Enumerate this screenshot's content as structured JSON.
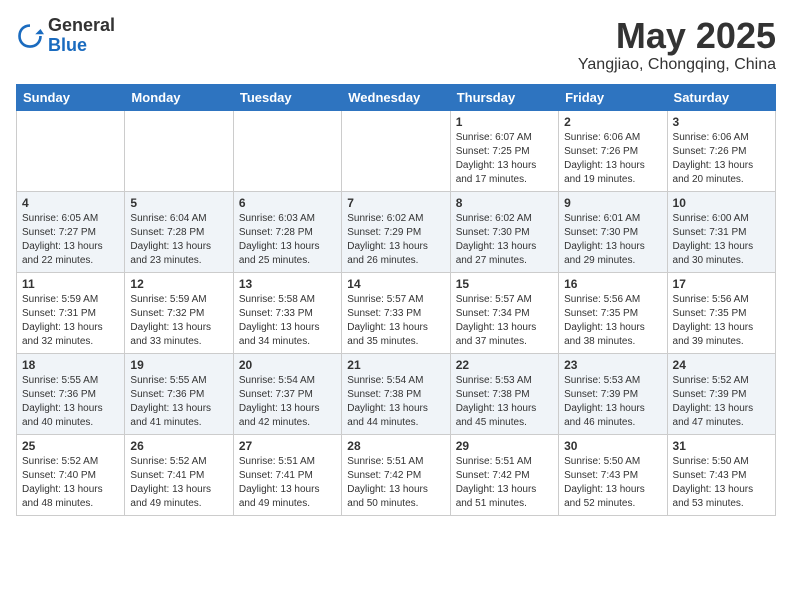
{
  "header": {
    "logo_general": "General",
    "logo_blue": "Blue",
    "month": "May 2025",
    "location": "Yangjiao, Chongqing, China"
  },
  "weekdays": [
    "Sunday",
    "Monday",
    "Tuesday",
    "Wednesday",
    "Thursday",
    "Friday",
    "Saturday"
  ],
  "weeks": [
    [
      {
        "day": "",
        "info": ""
      },
      {
        "day": "",
        "info": ""
      },
      {
        "day": "",
        "info": ""
      },
      {
        "day": "",
        "info": ""
      },
      {
        "day": "1",
        "info": "Sunrise: 6:07 AM\nSunset: 7:25 PM\nDaylight: 13 hours\nand 17 minutes."
      },
      {
        "day": "2",
        "info": "Sunrise: 6:06 AM\nSunset: 7:26 PM\nDaylight: 13 hours\nand 19 minutes."
      },
      {
        "day": "3",
        "info": "Sunrise: 6:06 AM\nSunset: 7:26 PM\nDaylight: 13 hours\nand 20 minutes."
      }
    ],
    [
      {
        "day": "4",
        "info": "Sunrise: 6:05 AM\nSunset: 7:27 PM\nDaylight: 13 hours\nand 22 minutes."
      },
      {
        "day": "5",
        "info": "Sunrise: 6:04 AM\nSunset: 7:28 PM\nDaylight: 13 hours\nand 23 minutes."
      },
      {
        "day": "6",
        "info": "Sunrise: 6:03 AM\nSunset: 7:28 PM\nDaylight: 13 hours\nand 25 minutes."
      },
      {
        "day": "7",
        "info": "Sunrise: 6:02 AM\nSunset: 7:29 PM\nDaylight: 13 hours\nand 26 minutes."
      },
      {
        "day": "8",
        "info": "Sunrise: 6:02 AM\nSunset: 7:30 PM\nDaylight: 13 hours\nand 27 minutes."
      },
      {
        "day": "9",
        "info": "Sunrise: 6:01 AM\nSunset: 7:30 PM\nDaylight: 13 hours\nand 29 minutes."
      },
      {
        "day": "10",
        "info": "Sunrise: 6:00 AM\nSunset: 7:31 PM\nDaylight: 13 hours\nand 30 minutes."
      }
    ],
    [
      {
        "day": "11",
        "info": "Sunrise: 5:59 AM\nSunset: 7:31 PM\nDaylight: 13 hours\nand 32 minutes."
      },
      {
        "day": "12",
        "info": "Sunrise: 5:59 AM\nSunset: 7:32 PM\nDaylight: 13 hours\nand 33 minutes."
      },
      {
        "day": "13",
        "info": "Sunrise: 5:58 AM\nSunset: 7:33 PM\nDaylight: 13 hours\nand 34 minutes."
      },
      {
        "day": "14",
        "info": "Sunrise: 5:57 AM\nSunset: 7:33 PM\nDaylight: 13 hours\nand 35 minutes."
      },
      {
        "day": "15",
        "info": "Sunrise: 5:57 AM\nSunset: 7:34 PM\nDaylight: 13 hours\nand 37 minutes."
      },
      {
        "day": "16",
        "info": "Sunrise: 5:56 AM\nSunset: 7:35 PM\nDaylight: 13 hours\nand 38 minutes."
      },
      {
        "day": "17",
        "info": "Sunrise: 5:56 AM\nSunset: 7:35 PM\nDaylight: 13 hours\nand 39 minutes."
      }
    ],
    [
      {
        "day": "18",
        "info": "Sunrise: 5:55 AM\nSunset: 7:36 PM\nDaylight: 13 hours\nand 40 minutes."
      },
      {
        "day": "19",
        "info": "Sunrise: 5:55 AM\nSunset: 7:36 PM\nDaylight: 13 hours\nand 41 minutes."
      },
      {
        "day": "20",
        "info": "Sunrise: 5:54 AM\nSunset: 7:37 PM\nDaylight: 13 hours\nand 42 minutes."
      },
      {
        "day": "21",
        "info": "Sunrise: 5:54 AM\nSunset: 7:38 PM\nDaylight: 13 hours\nand 44 minutes."
      },
      {
        "day": "22",
        "info": "Sunrise: 5:53 AM\nSunset: 7:38 PM\nDaylight: 13 hours\nand 45 minutes."
      },
      {
        "day": "23",
        "info": "Sunrise: 5:53 AM\nSunset: 7:39 PM\nDaylight: 13 hours\nand 46 minutes."
      },
      {
        "day": "24",
        "info": "Sunrise: 5:52 AM\nSunset: 7:39 PM\nDaylight: 13 hours\nand 47 minutes."
      }
    ],
    [
      {
        "day": "25",
        "info": "Sunrise: 5:52 AM\nSunset: 7:40 PM\nDaylight: 13 hours\nand 48 minutes."
      },
      {
        "day": "26",
        "info": "Sunrise: 5:52 AM\nSunset: 7:41 PM\nDaylight: 13 hours\nand 49 minutes."
      },
      {
        "day": "27",
        "info": "Sunrise: 5:51 AM\nSunset: 7:41 PM\nDaylight: 13 hours\nand 49 minutes."
      },
      {
        "day": "28",
        "info": "Sunrise: 5:51 AM\nSunset: 7:42 PM\nDaylight: 13 hours\nand 50 minutes."
      },
      {
        "day": "29",
        "info": "Sunrise: 5:51 AM\nSunset: 7:42 PM\nDaylight: 13 hours\nand 51 minutes."
      },
      {
        "day": "30",
        "info": "Sunrise: 5:50 AM\nSunset: 7:43 PM\nDaylight: 13 hours\nand 52 minutes."
      },
      {
        "day": "31",
        "info": "Sunrise: 5:50 AM\nSunset: 7:43 PM\nDaylight: 13 hours\nand 53 minutes."
      }
    ]
  ]
}
